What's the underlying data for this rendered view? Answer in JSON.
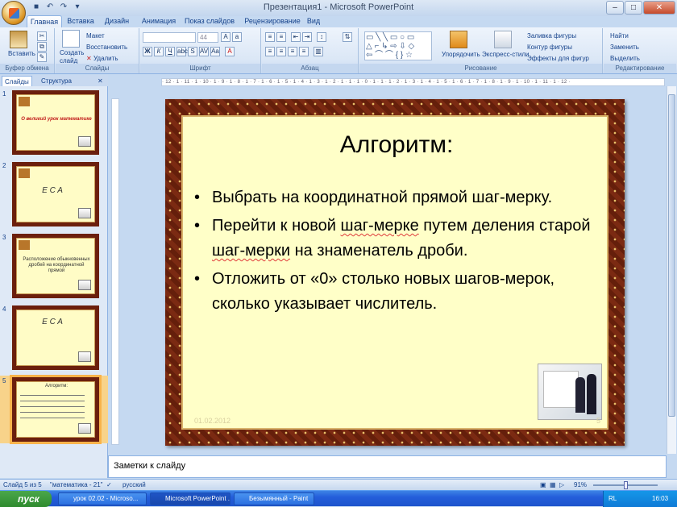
{
  "window": {
    "title": "Презентация1 - Microsoft PowerPoint"
  },
  "tabs": [
    "Главная",
    "Вставка",
    "Дизайн",
    "Анимация",
    "Показ слайдов",
    "Рецензирование",
    "Вид"
  ],
  "ribbon": {
    "clipboard": {
      "label": "Буфер обмена",
      "paste": "Вставить"
    },
    "slides": {
      "label": "Слайды",
      "create": "Создать слайд",
      "layout": "Макет",
      "reset": "Восстановить",
      "delete": "Удалить"
    },
    "font": {
      "label": "Шрифт",
      "size": "44"
    },
    "paragraph": {
      "label": "Абзац"
    },
    "drawing": {
      "label": "Рисование",
      "arrange": "Упорядочить",
      "quick_styles": "Экспресс-стили",
      "fill": "Заливка фигуры",
      "outline": "Контур фигуры",
      "effects": "Эффекты для фигур"
    },
    "editing": {
      "label": "Редактирование",
      "find": "Найти",
      "replace": "Заменить",
      "select": "Выделить"
    }
  },
  "panel": {
    "tab_slides": "Слайды",
    "tab_outline": "Структура"
  },
  "thumbs": [
    {
      "num": "1",
      "text": "О великий урок математике"
    },
    {
      "num": "2",
      "text": "E  C  A"
    },
    {
      "num": "3",
      "text": "Расположение обыкновенных дробей на координатной прямой"
    },
    {
      "num": "4",
      "text": "E  C  A"
    },
    {
      "num": "5",
      "text": "Алгоритм:"
    }
  ],
  "ruler": "· 12 · 1 · 11 · 1 · 10 · 1 · 9 · 1 · 8 · 1 · 7 · 1 · 6 · 1 · 5 · 1 · 4 · 1 · 3 · 1 · 2 · 1 · 1 · 1 · 0 · 1 · 1 · 1 · 2 · 1 · 3 · 1 · 4 · 1 · 5 · 1 · 6 · 1 · 7 · 1 · 8 · 1 · 9 · 1 · 10 · 1 · 11 · 1 · 12 ·",
  "slide": {
    "title": "Алгоритм:",
    "b1a": "Выбрать на координатной прямой шаг-мерку.",
    "b2a": "Перейти к новой ",
    "b2b": "шаг-мерке",
    "b2c": " путем деления старой ",
    "b2d": "шаг-мерки",
    "b2e": " на знаменатель дроби.",
    "b3a": "Отложить",
    "b3b": " от «0» столько новых шагов-мерок, сколько указывает числитель.",
    "date": "01.02.2012",
    "num": "5"
  },
  "notes": "Заметки к слайду",
  "status": {
    "slide": "Слайд 5 из 5",
    "theme": "\"математика - 21\"",
    "lang": "русский",
    "zoom": "91%"
  },
  "taskbar": {
    "start": "пуск",
    "items": [
      "урок 02.02 - Microso...",
      "Microsoft PowerPoint ...",
      "Безымянный - Paint"
    ],
    "lang": "RL",
    "time": "16:03"
  },
  "colors": {
    "slide_frame": "#7b2a12",
    "slide_bg": "#ffffc8",
    "ribbon": "#dbe7f6",
    "taskbar": "#245edb"
  }
}
